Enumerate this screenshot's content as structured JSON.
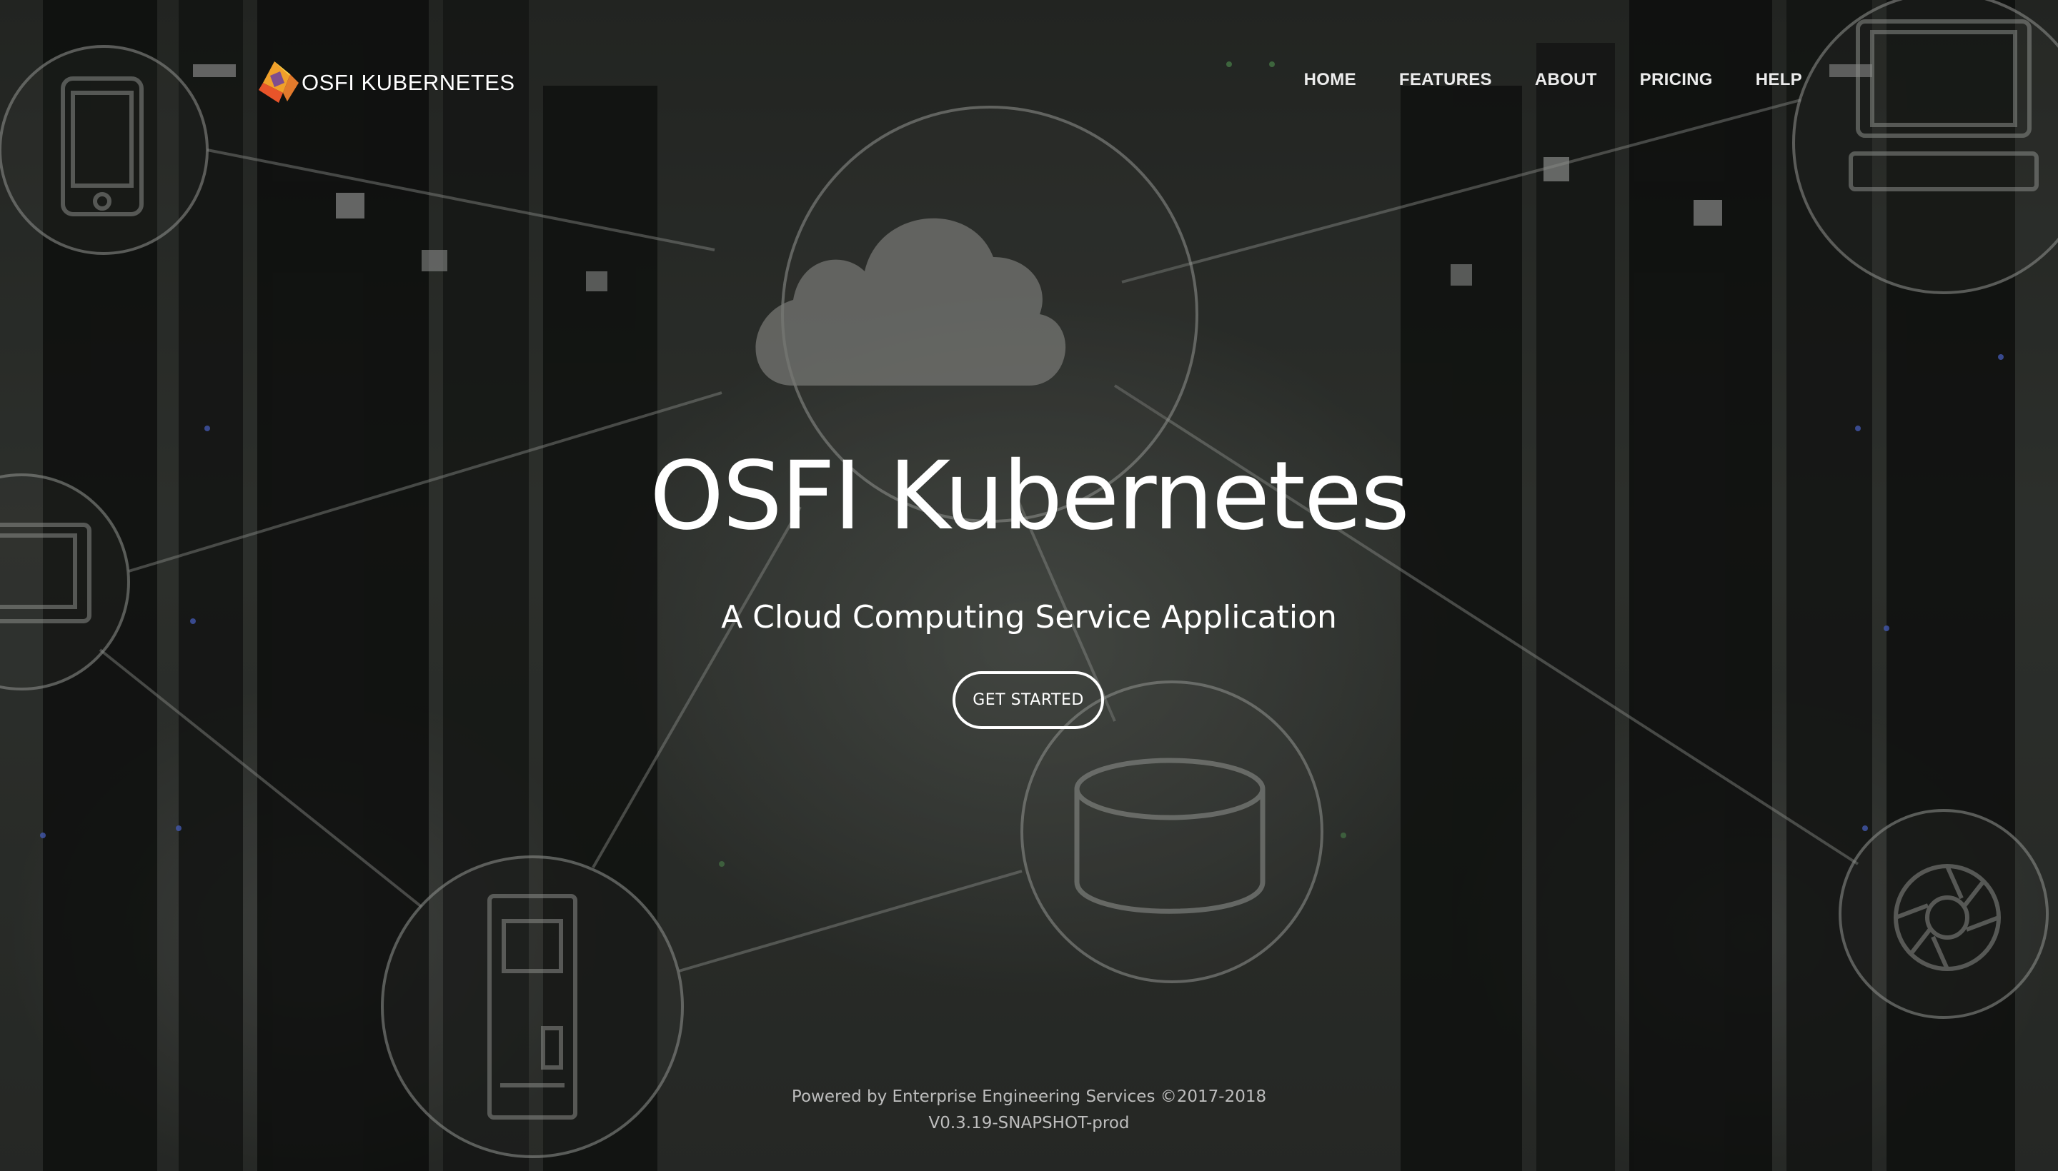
{
  "brand": {
    "name": "OSFI KUBERNETES",
    "logo_icon": "diamond-logo-icon",
    "logo_colors": [
      "#e8542a",
      "#f0a02a",
      "#f7d14a",
      "#6b3fa0"
    ]
  },
  "nav": {
    "items": [
      {
        "label": "HOME"
      },
      {
        "label": "FEATURES"
      },
      {
        "label": "ABOUT"
      },
      {
        "label": "PRICING"
      },
      {
        "label": "HELP"
      }
    ]
  },
  "hero": {
    "title": "OSFI Kubernetes",
    "subtitle": "A Cloud Computing Service Application",
    "cta_label": "GET STARTED"
  },
  "background": {
    "icons": [
      "phone-icon",
      "cloud-icon",
      "laptop-icon",
      "tablet-icon",
      "server-icon",
      "database-icon",
      "aperture-icon"
    ]
  },
  "footer": {
    "powered_by": "Powered by Enterprise Engineering Services ©2017-2018",
    "version": "V0.3.19-SNAPSHOT-prod"
  }
}
